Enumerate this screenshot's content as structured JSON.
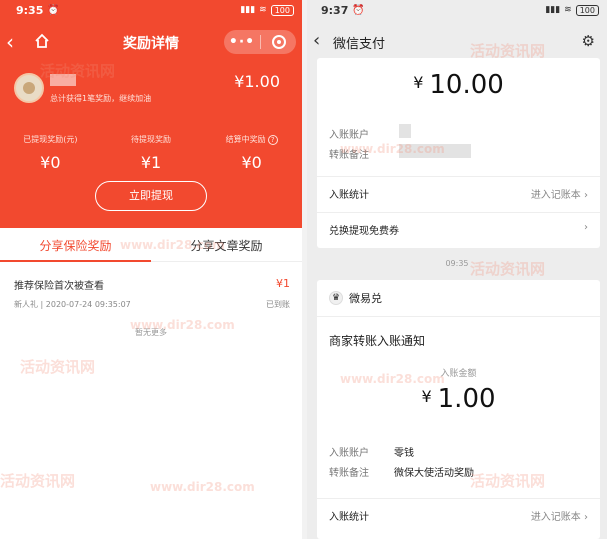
{
  "left": {
    "status": {
      "time": "9:35",
      "battery": "100"
    },
    "nav": {
      "title": "奖励详情",
      "more": "•·•"
    },
    "user": {
      "summary": "总计获得1笔奖励，继续加油",
      "total": "¥1.00"
    },
    "stats": [
      {
        "label": "已提现奖励(元)",
        "value": "¥0"
      },
      {
        "label": "待提现奖励",
        "value": "¥1"
      },
      {
        "label": "结算中奖励",
        "value": "¥0"
      }
    ],
    "withdraw_label": "立即提现",
    "tabs": [
      "分享保险奖励",
      "分享文章奖励"
    ],
    "record": {
      "title": "推荐保险首次被查看",
      "subtitle": "新人礼 | 2020-07-24 09:35:07",
      "amount": "¥1",
      "status": "已到账"
    },
    "no_more": "暂无更多"
  },
  "right": {
    "status": {
      "time": "9:37",
      "battery": "100"
    },
    "nav": {
      "title": "微信支付"
    },
    "card1": {
      "amount": "10.00",
      "currency": "¥",
      "account_label": "入账账户",
      "remark_label": "转账备注",
      "stats_label": "入账统计",
      "stats_link": "进入记账本",
      "coupon_label": "兑换提现免费券"
    },
    "time_sep": "09:35",
    "card2": {
      "app_name": "微易兑",
      "title": "商家转账入账通知",
      "recv_label": "入账金额",
      "currency": "¥",
      "amount": "1.00",
      "account_label": "入账账户",
      "account_value": "零钱",
      "remark_label": "转账备注",
      "remark_value": "微保大使活动奖励",
      "stats_label": "入账统计",
      "stats_link": "进入记账本"
    }
  },
  "watermark": {
    "cn": "活动资讯网",
    "url": "www.dir28.com"
  }
}
